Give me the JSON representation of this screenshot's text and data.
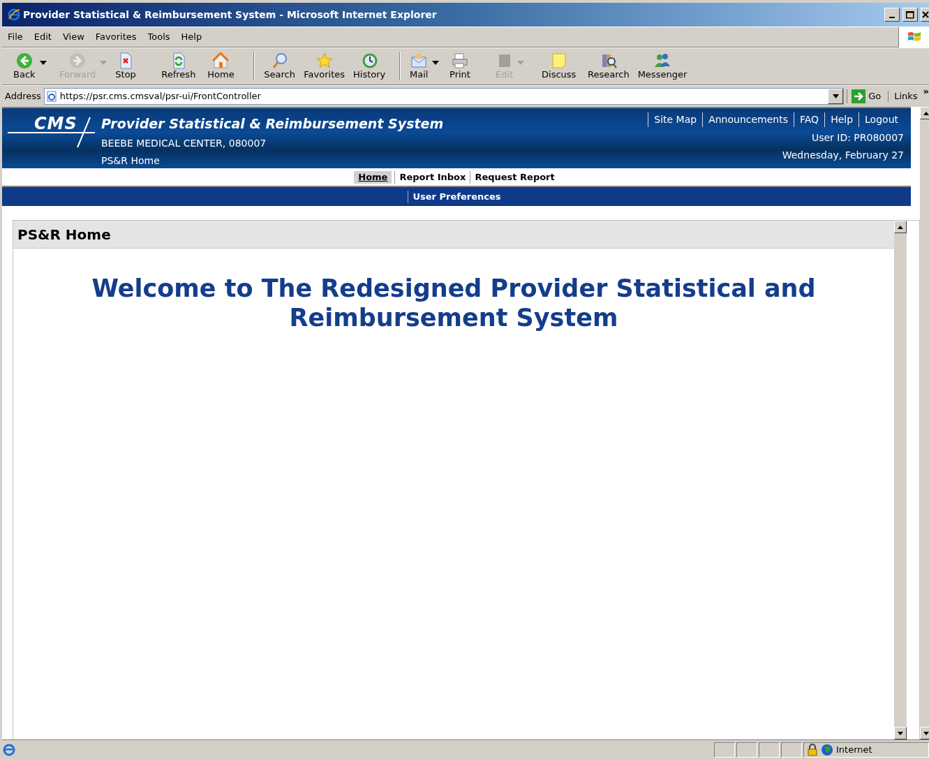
{
  "window": {
    "title": "Provider Statistical & Reimbursement System - Microsoft Internet Explorer"
  },
  "menu": [
    "File",
    "Edit",
    "View",
    "Favorites",
    "Tools",
    "Help"
  ],
  "toolbar": [
    {
      "label": "Back",
      "disabled": false,
      "dropdown": true,
      "separator_before": false
    },
    {
      "label": "Forward",
      "disabled": true,
      "dropdown": true,
      "separator_before": false
    },
    {
      "label": "Stop",
      "disabled": false,
      "dropdown": false,
      "separator_before": false
    },
    {
      "label": "Refresh",
      "disabled": false,
      "dropdown": false,
      "separator_before": false
    },
    {
      "label": "Home",
      "disabled": false,
      "dropdown": false,
      "separator_before": false
    },
    {
      "label": "Search",
      "disabled": false,
      "dropdown": false,
      "separator_before": true
    },
    {
      "label": "Favorites",
      "disabled": false,
      "dropdown": false,
      "separator_before": false
    },
    {
      "label": "History",
      "disabled": false,
      "dropdown": false,
      "separator_before": false
    },
    {
      "label": "Mail",
      "disabled": false,
      "dropdown": true,
      "separator_before": true
    },
    {
      "label": "Print",
      "disabled": false,
      "dropdown": false,
      "separator_before": false
    },
    {
      "label": "Edit",
      "disabled": true,
      "dropdown": true,
      "separator_before": false
    },
    {
      "label": "Discuss",
      "disabled": false,
      "dropdown": false,
      "separator_before": false
    },
    {
      "label": "Research",
      "disabled": false,
      "dropdown": false,
      "separator_before": false
    },
    {
      "label": "Messenger",
      "disabled": false,
      "dropdown": false,
      "separator_before": false
    }
  ],
  "address": {
    "label": "Address",
    "value": "https://psr.cms.cmsval/psr-ui/FrontController",
    "go": "Go",
    "links": "Links",
    "more": "»"
  },
  "header": {
    "logo": "CMS",
    "title": "Provider Statistical & Reimbursement System",
    "facility": "BEEBE MEDICAL CENTER, 080007",
    "breadcrumb": "PS&R Home",
    "links": [
      "Site Map",
      "Announcements",
      "FAQ",
      "Help",
      "Logout"
    ],
    "user_id": "User ID: PR080007",
    "date": "Wednesday, February 27"
  },
  "nav_tabs": [
    {
      "label": "Home",
      "selected": true
    },
    {
      "label": "Report Inbox",
      "selected": false
    },
    {
      "label": "Request Report",
      "selected": false
    }
  ],
  "sub_nav": [
    "User Preferences"
  ],
  "panel": {
    "title": "PS&R Home",
    "welcome": "Welcome to The Redesigned Provider Statistical and Reimbursement System"
  },
  "status_bar": {
    "zone": "Internet"
  }
}
